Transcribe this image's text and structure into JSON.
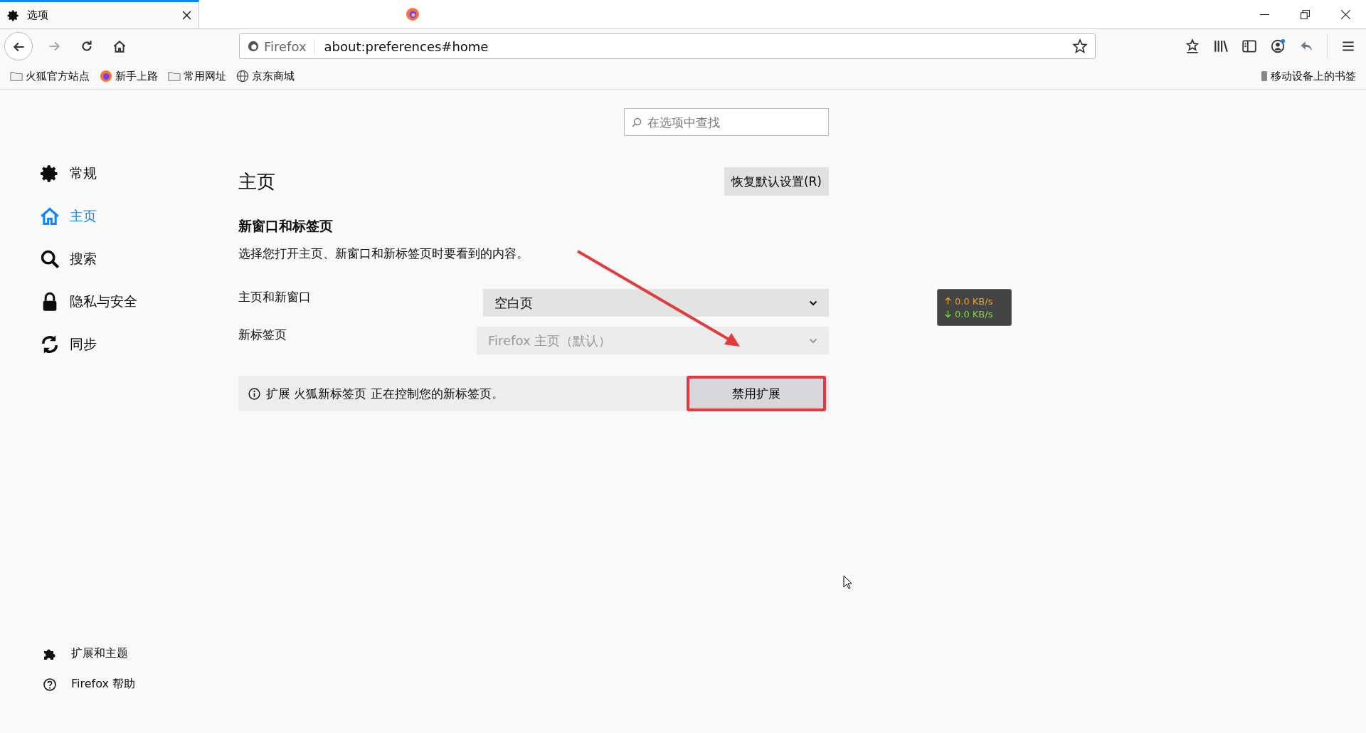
{
  "tabs": [
    {
      "title": "选项",
      "selected": true
    }
  ],
  "toolbar": {
    "identity": "Firefox",
    "url": "about:preferences#home",
    "sync_badge": true
  },
  "bookmarks": [
    {
      "kind": "folder",
      "label": "火狐官方站点"
    },
    {
      "kind": "firefox",
      "label": "新手上路"
    },
    {
      "kind": "folder",
      "label": "常用网址"
    },
    {
      "kind": "globe",
      "label": "京东商城"
    }
  ],
  "mobile_bookmarks": "移动设备上的书签",
  "search": {
    "placeholder": "在选项中查找"
  },
  "sidebar": {
    "items": [
      {
        "kind": "gear",
        "label": "常规",
        "selected": false
      },
      {
        "kind": "home",
        "label": "主页",
        "selected": true
      },
      {
        "kind": "search",
        "label": "搜索",
        "selected": false
      },
      {
        "kind": "lock",
        "label": "隐私与安全",
        "selected": false
      },
      {
        "kind": "sync",
        "label": "同步",
        "selected": false
      }
    ],
    "footer": [
      {
        "kind": "puzzle",
        "label": "扩展和主题"
      },
      {
        "kind": "help",
        "label": "Firefox 帮助"
      }
    ]
  },
  "main": {
    "title": "主页",
    "restore_button": "恢复默认设置(R)",
    "section_title": "新窗口和标签页",
    "description": "选择您打开主页、新窗口和新标签页时要看到的内容。",
    "settings": [
      {
        "label": "主页和新窗口",
        "value": "空白页",
        "disabled": false
      },
      {
        "label": "新标签页",
        "value": "Firefox 主页（默认）",
        "disabled": true
      }
    ],
    "notice": {
      "text": "扩展 火狐新标签页 正在控制您的新标签页。",
      "button": "禁用扩展",
      "highlighted": true
    }
  },
  "net_monitor": {
    "upload": "0.0 KB/s",
    "download": "0.0 KB/s"
  }
}
